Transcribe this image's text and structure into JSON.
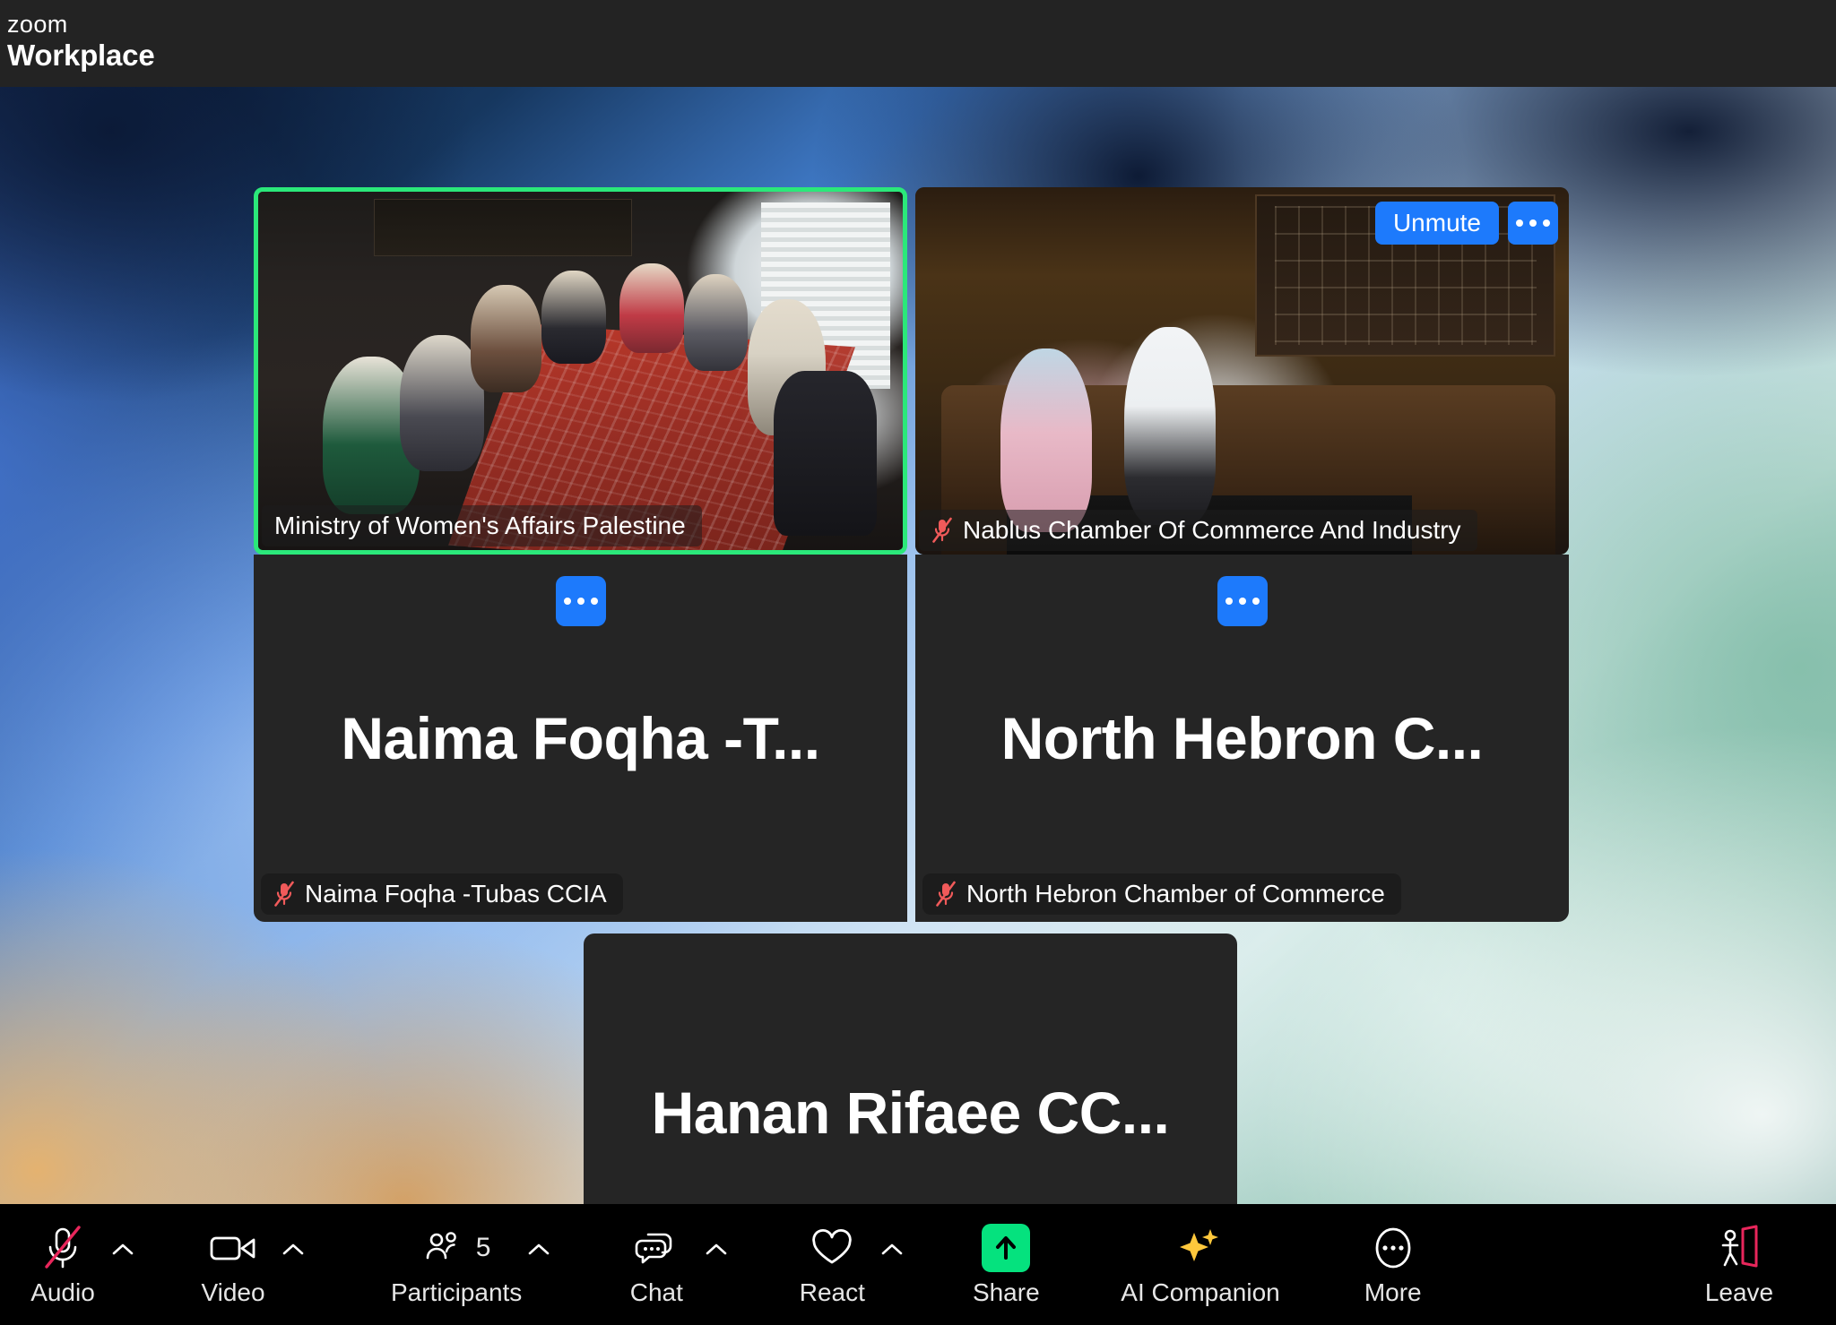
{
  "header": {
    "brand_line1": "zoom",
    "brand_line2": "Workplace"
  },
  "colors": {
    "active_speaker_border": "#2BE87A",
    "action_button_blue": "#1D7AFC",
    "share_green": "#05E27E",
    "muted_red": "#F05A5A",
    "leave_pink": "#E8265B",
    "ai_yellow": "#FFC83C",
    "tile_background": "#252525",
    "header_background": "#232323",
    "toolbar_background": "#000000"
  },
  "gallery": {
    "tiles": [
      {
        "id": "tile-1",
        "name": "Ministry of Women's Affairs Palestine",
        "has_video": true,
        "muted": false,
        "active_speaker": true,
        "placeholder_text": ""
      },
      {
        "id": "tile-2",
        "name": "Nablus Chamber Of Commerce And Industry",
        "has_video": true,
        "muted": true,
        "active_speaker": false,
        "placeholder_text": ""
      },
      {
        "id": "tile-3",
        "name": "Naima Foqha -Tubas CCIA",
        "has_video": false,
        "muted": true,
        "active_speaker": false,
        "placeholder_text": "Naima Foqha -T..."
      },
      {
        "id": "tile-4",
        "name": "North Hebron Chamber of Commerce",
        "has_video": false,
        "muted": true,
        "active_speaker": false,
        "placeholder_text": "North Hebron C..."
      },
      {
        "id": "tile-5",
        "name": "Hanan Rifaee CCI EBDC",
        "has_video": false,
        "muted": true,
        "active_speaker": false,
        "placeholder_text": "Hanan Rifaee CC..."
      }
    ],
    "tile_actions": {
      "unmute_label": "Unmute",
      "more_options_icon": "ellipsis-icon"
    }
  },
  "toolbar": {
    "items": [
      {
        "label": "Audio",
        "icon": "microphone-muted-icon",
        "has_caret": true,
        "count": null
      },
      {
        "label": "Video",
        "icon": "video-camera-icon",
        "has_caret": true,
        "count": null
      },
      {
        "label": "Participants",
        "icon": "participants-icon",
        "has_caret": true,
        "count": "5"
      },
      {
        "label": "Chat",
        "icon": "chat-bubble-icon",
        "has_caret": true,
        "count": null
      },
      {
        "label": "React",
        "icon": "heart-icon",
        "has_caret": true,
        "count": null
      },
      {
        "label": "Share",
        "icon": "share-screen-icon",
        "has_caret": false,
        "count": null
      },
      {
        "label": "AI Companion",
        "icon": "sparkles-icon",
        "has_caret": false,
        "count": null
      },
      {
        "label": "More",
        "icon": "more-ellipsis-circle-icon",
        "has_caret": false,
        "count": null
      },
      {
        "label": "Leave",
        "icon": "leave-door-icon",
        "has_caret": false,
        "count": null
      }
    ]
  }
}
